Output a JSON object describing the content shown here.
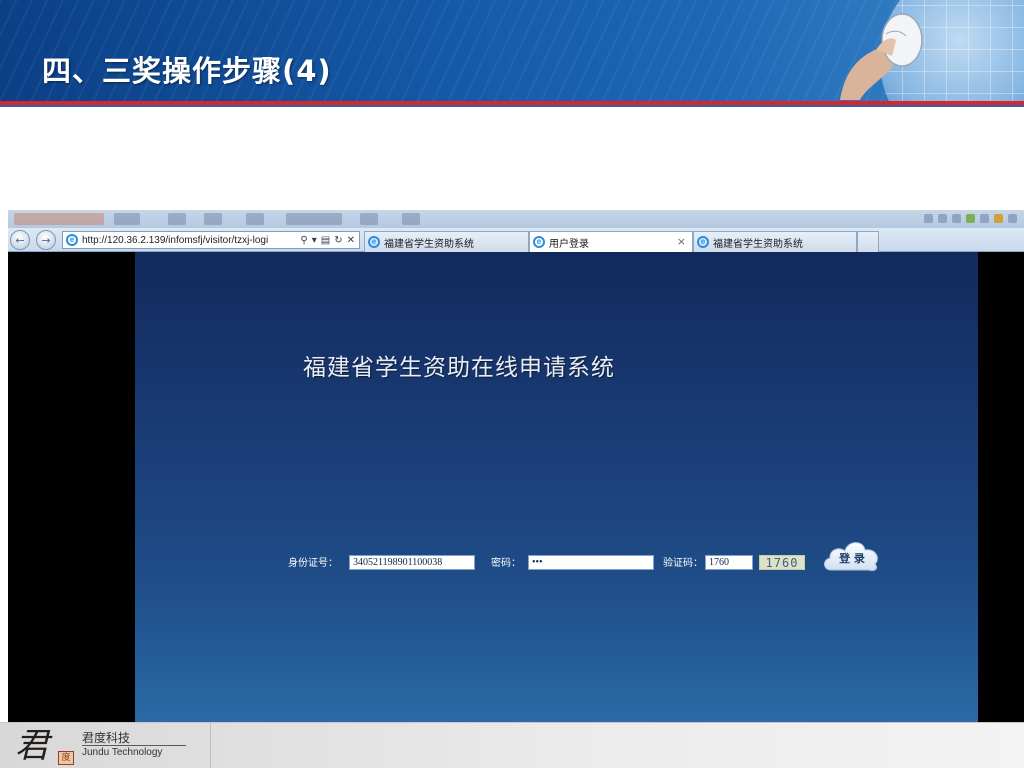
{
  "slide": {
    "title": "四、三奖操作步骤(4)"
  },
  "browser": {
    "url": "http://120.36.2.139/infomsfj/visitor/tzxj-logi",
    "url_icons": [
      "search-icon",
      "dropdown-icon",
      "compatibility-icon",
      "refresh-icon",
      "stop-icon"
    ],
    "tabs": [
      {
        "label": "福建省学生资助系统",
        "active": false
      },
      {
        "label": "用户登录",
        "active": true,
        "close": "×"
      },
      {
        "label": "福建省学生资助系统",
        "active": false
      }
    ]
  },
  "page": {
    "title": "福建省学生资助在线申请系统",
    "form": {
      "id_label": "身份证号：",
      "id_value": "340521198901100038",
      "password_label": "密码：",
      "password_value": "•••",
      "captcha_label": "验证码：",
      "captcha_value": "1760",
      "captcha_image_text": "1760",
      "login_label": "登 录"
    }
  },
  "footer": {
    "logo_chinese": "君度科技",
    "logo_english": "Jundu Technology",
    "logo_glyph": "君",
    "logo_seal": "度"
  }
}
